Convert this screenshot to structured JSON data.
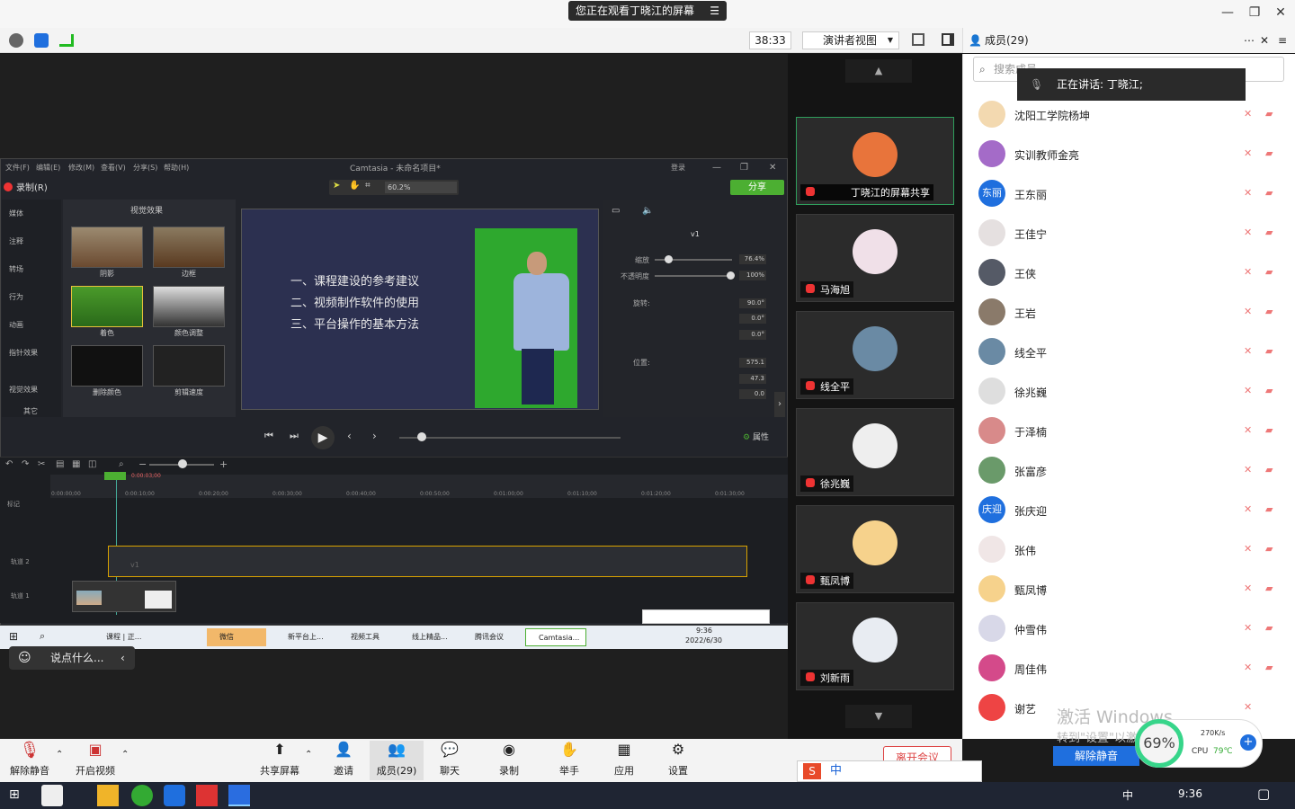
{
  "window": {
    "banner": "您正在观看丁晓江的屏幕",
    "timer": "38:33",
    "view_mode": "演讲者视图",
    "members_header": "成员(29)"
  },
  "camtasia": {
    "title": "Camtasia - 未命名项目*",
    "menus": [
      "文件(F)",
      "编辑(E)",
      "修改(M)",
      "查看(V)",
      "分享(S)",
      "帮助(H)"
    ],
    "login": "登录",
    "record": "录制(R)",
    "zoom": "60.2%",
    "share": "分享",
    "side_items": [
      "媒体",
      "注释",
      "转场",
      "行为",
      "动画",
      "指针效果",
      "视觉效果",
      "其它"
    ],
    "fx_title": "视觉效果",
    "fx_items": [
      "阴影",
      "边框",
      "着色",
      "颜色调整",
      "删除颜色",
      "剪辑速度"
    ],
    "slide_lines": [
      "一、课程建设的参考建议",
      "二、视频制作软件的使用",
      "三、平台操作的基本方法"
    ],
    "props": {
      "clip_name": "v1",
      "scale_label": "缩放",
      "scale": "76.4%",
      "opacity_label": "不透明度",
      "opacity": "100%",
      "rotate_label": "旋转:",
      "rot_z": "90.0°",
      "rot_y": "0.0°",
      "rot_x": "0.0°",
      "pos_label": "位置:",
      "pos_x": "575.1",
      "pos_y": "47.3",
      "pos_z": "0.0"
    },
    "properties_btn": "属性",
    "playhead_time": "0:00:03;00",
    "ruler": [
      "0:00:00;00",
      "0:00:10;00",
      "0:00:20;00",
      "0:00:30;00",
      "0:00:40;00",
      "0:00:50;00",
      "0:01:00;00",
      "0:01:10;00",
      "0:01:20;00",
      "0:01:30;00"
    ],
    "marker_label": "标记",
    "track2": "轨道 2",
    "track1": "轨道 1",
    "clip_label": "v1"
  },
  "remote_taskbar": {
    "items": [
      "课程 | 正...",
      "微信",
      "新平台上...",
      "视频工具",
      "线上精品...",
      "腾讯会议",
      "Camtasia..."
    ],
    "time": "9:36",
    "date": "2022/6/30"
  },
  "say_placeholder": "说点什么...",
  "videos": [
    {
      "name": "丁晓江的屏幕共享",
      "active": true,
      "color": "#e8743b"
    },
    {
      "name": "马海旭",
      "active": false,
      "color": "#f0e0e8"
    },
    {
      "name": "线全平",
      "active": false,
      "color": "#6a8aa4"
    },
    {
      "name": "徐兆巍",
      "active": false,
      "color": "#eeeeee"
    },
    {
      "name": "甄凤博",
      "active": false,
      "color": "#f6d28c"
    },
    {
      "name": "刘新雨",
      "active": false,
      "color": "#e8ecf2"
    }
  ],
  "search_placeholder": "搜索成员",
  "speaking": "正在讲话: 丁晓江;",
  "members": [
    {
      "name": "沈阳工学院杨坤",
      "avatar": "",
      "color": "#f3d9b0"
    },
    {
      "name": "实训教师金亮",
      "avatar": "",
      "color": "#a46bc8"
    },
    {
      "name": "王东丽",
      "avatar": "东丽",
      "color": "#1f6fde"
    },
    {
      "name": "王佳宁",
      "avatar": "",
      "color": "#e5e0e0"
    },
    {
      "name": "王侠",
      "avatar": "",
      "color": "#555a66"
    },
    {
      "name": "王岩",
      "avatar": "",
      "color": "#8a7a6a"
    },
    {
      "name": "线全平",
      "avatar": "",
      "color": "#6a8aa4"
    },
    {
      "name": "徐兆巍",
      "avatar": "",
      "color": "#dedede"
    },
    {
      "name": "于泽楠",
      "avatar": "",
      "color": "#d88a8a"
    },
    {
      "name": "张富彦",
      "avatar": "",
      "color": "#6a9a6a"
    },
    {
      "name": "张庆迎",
      "avatar": "庆迎",
      "color": "#1f6fde"
    },
    {
      "name": "张伟",
      "avatar": "",
      "color": "#f0e6e6"
    },
    {
      "name": "甄凤博",
      "avatar": "",
      "color": "#f6d28c"
    },
    {
      "name": "仲雪伟",
      "avatar": "",
      "color": "#d8d8e8"
    },
    {
      "name": "周佳伟",
      "avatar": "",
      "color": "#d44a8a"
    },
    {
      "name": "谢艺",
      "avatar": "",
      "color": "#e44"
    }
  ],
  "activation": {
    "line1": "激活 Windows",
    "line2": "转到\"设置\"以激活 Windows。"
  },
  "unmute_all": "解除静音",
  "cpu": {
    "percent": "69%",
    "net": "270K/s",
    "cpu_label": "CPU",
    "cpu_temp": "79℃"
  },
  "bottom": {
    "mute": "解除静音",
    "video": "开启视频",
    "share": "共享屏幕",
    "invite": "邀请",
    "members": "成员(29)",
    "chat": "聊天",
    "record": "录制",
    "hand": "举手",
    "apps": "应用",
    "settings": "设置",
    "leave": "离开会议"
  },
  "ime": "中",
  "taskbar": {
    "lang": "中",
    "time": "9:36"
  }
}
